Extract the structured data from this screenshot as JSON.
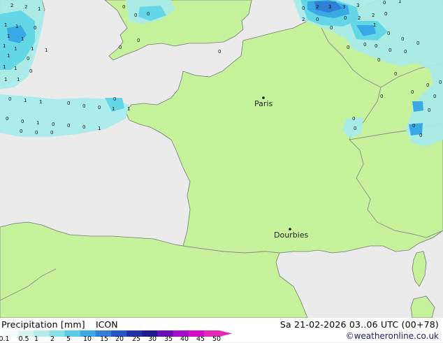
{
  "map": {
    "colors": {
      "sea": "#ebebeb",
      "land": "#c5f29b",
      "border": "#8a8a8a",
      "coast": "#777777",
      "precip_light": "#a7ecec",
      "precip_mid": "#60d6e6",
      "precip_dark": "#3aa8e4",
      "precip_heavy": "#2f7fd6"
    },
    "cities": [
      {
        "name": "Paris",
        "marker": "dot-icon"
      },
      {
        "name": "Dourbies",
        "marker": "dot-icon"
      }
    ],
    "precip_values": {
      "nw_corner": [
        "2",
        "2",
        "1",
        "1",
        "1",
        "0",
        "1",
        "1",
        "1",
        "1",
        "1",
        "1",
        "1",
        "0",
        "1",
        "1",
        "0",
        "1",
        "1"
      ],
      "channel": [
        "0",
        "1",
        "1",
        "0",
        "0",
        "0",
        "1",
        "0",
        "0",
        "1",
        "0",
        "0",
        "0",
        "1",
        "0",
        "0",
        "0",
        "1",
        "0"
      ],
      "top_center": [
        "0",
        "0",
        "0",
        "0",
        "0",
        "0"
      ],
      "ne_cluster": [
        "0",
        "2",
        "3",
        "3",
        "3",
        "2",
        "0",
        "0",
        "0",
        "2",
        "2",
        "0",
        "1",
        "0",
        "1",
        "0",
        "0",
        "0",
        "0",
        "0",
        "0",
        "0",
        "0",
        "0",
        "0",
        "0",
        "0",
        "0",
        "0",
        "0",
        "0",
        "0",
        "0",
        "0",
        "0"
      ]
    }
  },
  "footer": {
    "title": "Precipitation [mm]",
    "model": "ICON",
    "datetime": "Sa 21-02-2026 03..06 UTC (00+78)",
    "credit": "©weatheronline.co.uk",
    "colorbar": {
      "ticks": [
        "0.1",
        "0.5",
        "1",
        "2",
        "5",
        "10",
        "15",
        "20",
        "25",
        "30",
        "35",
        "40",
        "45",
        "50"
      ],
      "colors": [
        "#f4fbfb",
        "#d6f4f4",
        "#b4ecec",
        "#86e1e8",
        "#5ccce6",
        "#3aa8e4",
        "#2f7fd6",
        "#2556c4",
        "#1d31a8",
        "#1f1a8e",
        "#6a0fb8",
        "#a40dcb",
        "#d20cc7",
        "#e42bb8"
      ]
    }
  }
}
